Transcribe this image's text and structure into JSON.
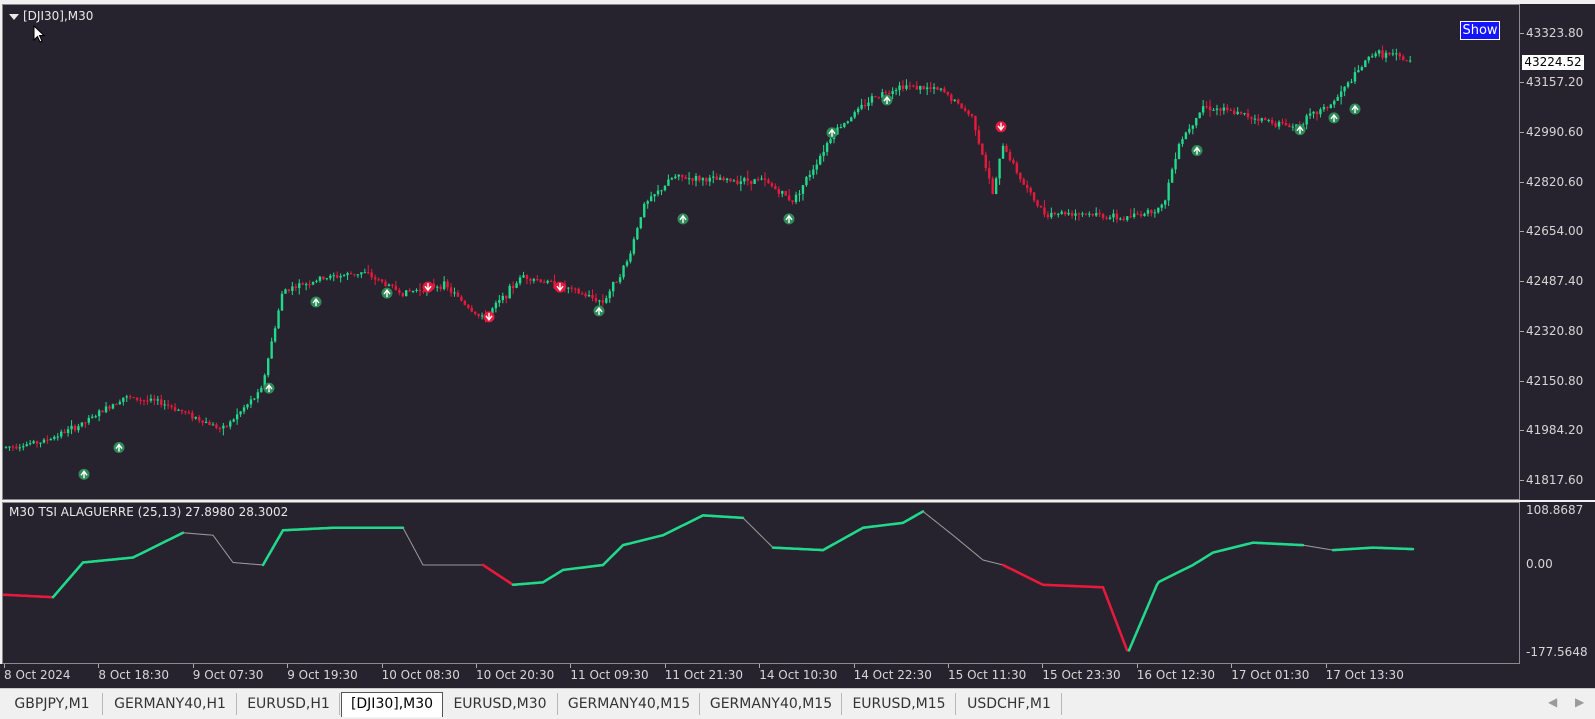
{
  "chart": {
    "title": "[DJI30],M30",
    "show_button": "Show",
    "bid_price": "43224.52",
    "price_axis": [
      "43323.80",
      "43157.20",
      "42990.60",
      "42820.60",
      "42654.00",
      "42487.40",
      "42320.80",
      "42150.80",
      "41984.20",
      "41817.60"
    ],
    "price_min": 41750,
    "price_max": 43420
  },
  "indicator": {
    "title": "M30  TSI ALAGUERRE (25,13) 27.8980 28.3002",
    "axis": [
      "108.8687",
      "0.00",
      "-177.5648"
    ]
  },
  "time_axis": [
    "8 Oct 2024",
    "8 Oct 18:30",
    "9 Oct 07:30",
    "9 Oct 19:30",
    "10 Oct 08:30",
    "10 Oct 20:30",
    "11 Oct 09:30",
    "11 Oct 21:30",
    "14 Oct 10:30",
    "14 Oct 22:30",
    "15 Oct 11:30",
    "15 Oct 23:30",
    "16 Oct 12:30",
    "17 Oct 01:30",
    "17 Oct 13:30"
  ],
  "tabs": [
    "GBPJPY,M1",
    "GERMANY40,H1",
    "EURUSD,H1",
    "[DJI30],M30",
    "EURUSD,M30",
    "GERMANY40,M15",
    "GERMANY40,M15",
    "EURUSD,M15",
    "USDCHF,M1"
  ],
  "active_tab": "[DJI30],M30",
  "colors": {
    "bull": "#21d98a",
    "bear": "#e8193c",
    "neutral": "#9a9a9a",
    "background": "#27232e",
    "marker": "#2e8b57"
  },
  "chart_data": {
    "type": "candlestick",
    "price_path": [
      [
        0,
        41930
      ],
      [
        40,
        41950
      ],
      [
        80,
        42010
      ],
      [
        120,
        42100
      ],
      [
        160,
        42080
      ],
      [
        220,
        41990
      ],
      [
        258,
        42120
      ],
      [
        280,
        42460
      ],
      [
        320,
        42500
      ],
      [
        360,
        42520
      ],
      [
        400,
        42450
      ],
      [
        440,
        42480
      ],
      [
        480,
        42360
      ],
      [
        520,
        42510
      ],
      [
        560,
        42470
      ],
      [
        600,
        42420
      ],
      [
        625,
        42560
      ],
      [
        640,
        42740
      ],
      [
        670,
        42840
      ],
      [
        720,
        42830
      ],
      [
        760,
        42830
      ],
      [
        790,
        42760
      ],
      [
        810,
        42870
      ],
      [
        830,
        42990
      ],
      [
        870,
        43110
      ],
      [
        900,
        43150
      ],
      [
        940,
        43130
      ],
      [
        970,
        43040
      ],
      [
        990,
        42780
      ],
      [
        1000,
        42950
      ],
      [
        1020,
        42820
      ],
      [
        1040,
        42720
      ],
      [
        1080,
        42720
      ],
      [
        1120,
        42700
      ],
      [
        1160,
        42740
      ],
      [
        1175,
        42950
      ],
      [
        1200,
        43080
      ],
      [
        1240,
        43050
      ],
      [
        1290,
        43010
      ],
      [
        1330,
        43090
      ],
      [
        1370,
        43260
      ],
      [
        1390,
        43250
      ],
      [
        1410,
        43224
      ]
    ],
    "tsi_path": [
      [
        0,
        -60
      ],
      [
        50,
        -65
      ],
      [
        80,
        5
      ],
      [
        130,
        15
      ],
      [
        180,
        65
      ],
      [
        210,
        60
      ],
      [
        230,
        5
      ],
      [
        260,
        0
      ],
      [
        280,
        70
      ],
      [
        330,
        75
      ],
      [
        400,
        75
      ],
      [
        420,
        0
      ],
      [
        480,
        0
      ],
      [
        510,
        -40
      ],
      [
        540,
        -35
      ],
      [
        560,
        -10
      ],
      [
        600,
        0
      ],
      [
        620,
        40
      ],
      [
        660,
        60
      ],
      [
        700,
        100
      ],
      [
        740,
        95
      ],
      [
        770,
        35
      ],
      [
        820,
        30
      ],
      [
        860,
        75
      ],
      [
        900,
        85
      ],
      [
        920,
        108
      ],
      [
        950,
        60
      ],
      [
        980,
        10
      ],
      [
        1000,
        0
      ],
      [
        1040,
        -40
      ],
      [
        1100,
        -45
      ],
      [
        1125,
        -177
      ],
      [
        1155,
        -35
      ],
      [
        1190,
        0
      ],
      [
        1210,
        25
      ],
      [
        1250,
        45
      ],
      [
        1300,
        40
      ],
      [
        1330,
        30
      ],
      [
        1370,
        35
      ],
      [
        1410,
        32
      ]
    ],
    "tsi_range": [
      -177.5648,
      108.8687
    ],
    "up_markers": [
      [
        81,
        41840
      ],
      [
        116,
        41930
      ],
      [
        266,
        42130
      ],
      [
        313,
        42420
      ],
      [
        384,
        42450
      ],
      [
        596,
        42390
      ],
      [
        680,
        42700
      ],
      [
        786,
        42700
      ],
      [
        829,
        42990
      ],
      [
        884,
        43100
      ],
      [
        1194,
        42930
      ],
      [
        1297,
        43000
      ],
      [
        1331,
        43040
      ],
      [
        1352,
        43070
      ]
    ],
    "down_markers": [
      [
        425,
        42470
      ],
      [
        557,
        42470
      ],
      [
        486,
        42370
      ],
      [
        998,
        43010
      ]
    ]
  }
}
